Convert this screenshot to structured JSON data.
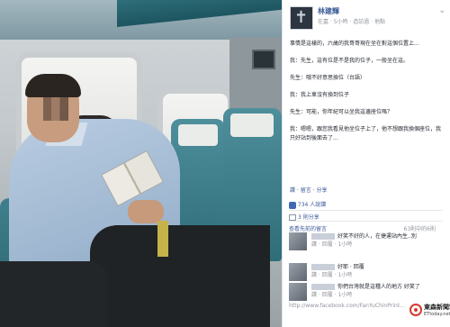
{
  "post": {
    "author": "林建輝",
    "meta": "在嘉 · 5小時 · 造訪過 · 地點",
    "paragraphs": [
      "事情是這樣的，六歲的我哥哥現在坐在對這個位置上...",
      "我：先生，這有位是不是我的位子，一般坐在這。",
      "先生：哦不好意思換位（台語）",
      "我：我上車沒有換到位子",
      "先生：可能，你年紀可以坐我這邊座位嗎？",
      "我：嗯嗯，跟您我看見他坐位子上了，他不想跟我換個座位，我只好站到後面去了..."
    ]
  },
  "actions": {
    "like": "讚",
    "comment": "留言",
    "share": "分享"
  },
  "likes_text": "734 人說讚",
  "shares_text": "3 則分享",
  "more_comments": "查看先前的留言",
  "page_count": "63則中的6則",
  "comments": [
    {
      "text": "好笑不好的人，在捷運站內生..別",
      "meta": "讚 · 回覆 · 1小時"
    },
    {
      "text": "好耶 · 回覆",
      "meta": "讚 · 回覆 · 1小時"
    },
    {
      "text": "你們台灣就是這種人的地方 好笑了",
      "meta": "讚 · 回覆 · 1小時"
    }
  ],
  "bottom_link": "http://www.facebook.com/FanYuChinPrint..."
}
